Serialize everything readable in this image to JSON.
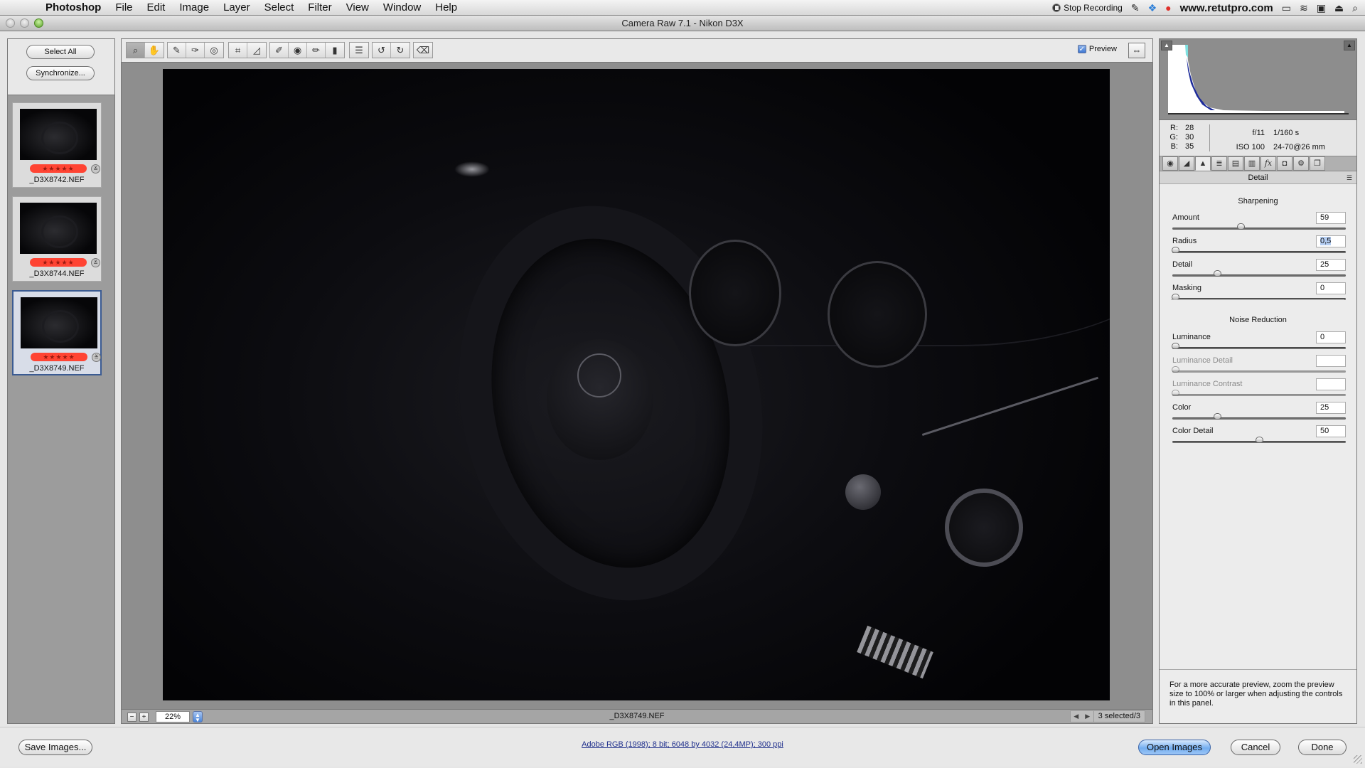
{
  "menubar": {
    "app_name": "Photoshop",
    "items": [
      "File",
      "Edit",
      "Image",
      "Layer",
      "Select",
      "Filter",
      "View",
      "Window",
      "Help"
    ],
    "right": {
      "recording_label": "Stop Recording",
      "site_label": "www.retutpro.com"
    }
  },
  "window": {
    "title": "Camera Raw 7.1  -  Nikon D3X"
  },
  "filmstrip": {
    "select_all_label": "Select All",
    "synchronize_label": "Synchronize...",
    "thumbnails": [
      {
        "name": "_D3X8742.NEF",
        "rating": 5,
        "selected": false
      },
      {
        "name": "_D3X8744.NEF",
        "rating": 5,
        "selected": false
      },
      {
        "name": "_D3X8749.NEF",
        "rating": 5,
        "selected": true
      }
    ],
    "stars_glyph": "★★★★★"
  },
  "toolbar": {
    "tools": [
      {
        "name": "zoom-tool",
        "glyph": "🔍",
        "active": true
      },
      {
        "name": "hand-tool",
        "glyph": "✋",
        "active": false
      },
      {
        "name": "white-balance-tool",
        "glyph": "✎",
        "active": false
      },
      {
        "name": "color-sampler-tool",
        "glyph": "✑",
        "active": false
      },
      {
        "name": "targeted-adjustment-tool",
        "glyph": "◎",
        "active": false
      },
      {
        "name": "crop-tool",
        "glyph": "⌗",
        "active": false
      },
      {
        "name": "straighten-tool",
        "glyph": "◿",
        "active": false
      },
      {
        "name": "spot-removal-tool",
        "glyph": "✐",
        "active": false
      },
      {
        "name": "red-eye-removal-tool",
        "glyph": "◉",
        "active": false
      },
      {
        "name": "adjustment-brush-tool",
        "glyph": "✏",
        "active": false
      },
      {
        "name": "graduated-filter-tool",
        "glyph": "▮",
        "active": false
      },
      {
        "name": "preferences-tool",
        "glyph": "☰",
        "active": false
      },
      {
        "name": "rotate-left-tool",
        "glyph": "↺",
        "active": false
      },
      {
        "name": "rotate-right-tool",
        "glyph": "↻",
        "active": false
      },
      {
        "name": "delete-tool",
        "glyph": "🗑",
        "active": false
      }
    ],
    "preview_label": "Preview",
    "preview_checked": true,
    "checkmark": "✓",
    "fullscreen_glyph": "⇔"
  },
  "status": {
    "zoom_out": "−",
    "zoom_in": "+",
    "zoom_level": "22%",
    "stepper_glyph": "▲▼",
    "filename": "_D3X8749.NEF",
    "prev_arrow": "◀",
    "next_arrow": "▶",
    "selection_count": "3 selected/3"
  },
  "histogram": {
    "shadow_clip_glyph": "▲",
    "highlight_clip_glyph": "▲",
    "readout": {
      "R": "28",
      "G": "30",
      "B": "35"
    },
    "labels": {
      "R": "R:",
      "G": "G:",
      "B": "B:"
    },
    "exif": {
      "aperture": "f/11",
      "shutter": "1/160 s",
      "iso": "ISO 100",
      "lens": "24-70@26 mm"
    }
  },
  "panel": {
    "tabs": [
      {
        "name": "basic",
        "glyph": "◉"
      },
      {
        "name": "tone-curve",
        "glyph": "◢"
      },
      {
        "name": "detail",
        "glyph": "▲",
        "active": true
      },
      {
        "name": "hsl",
        "glyph": "≣"
      },
      {
        "name": "split-toning",
        "glyph": "▤"
      },
      {
        "name": "lens-corrections",
        "glyph": "▥"
      },
      {
        "name": "effects",
        "glyph": "fx"
      },
      {
        "name": "camera-calibration",
        "glyph": "◘"
      },
      {
        "name": "presets",
        "glyph": "⚙"
      },
      {
        "name": "snapshots",
        "glyph": "❐"
      }
    ],
    "title": "Detail",
    "menu_glyph": "☰",
    "sharpening": {
      "title": "Sharpening",
      "sliders": [
        {
          "label": "Amount",
          "value": "59",
          "fraction": 0.39,
          "enabled": true,
          "selected": false
        },
        {
          "label": "Radius",
          "value": "0,5",
          "fraction": 0.0,
          "enabled": true,
          "selected": true
        },
        {
          "label": "Detail",
          "value": "25",
          "fraction": 0.25,
          "enabled": true,
          "selected": false
        },
        {
          "label": "Masking",
          "value": "0",
          "fraction": 0.0,
          "enabled": true,
          "selected": false
        }
      ]
    },
    "noise_reduction": {
      "title": "Noise Reduction",
      "sliders": [
        {
          "label": "Luminance",
          "value": "0",
          "fraction": 0.0,
          "enabled": true,
          "selected": false
        },
        {
          "label": "Luminance Detail",
          "value": "",
          "fraction": 0.0,
          "enabled": false,
          "selected": false
        },
        {
          "label": "Luminance Contrast",
          "value": "",
          "fraction": 0.0,
          "enabled": false,
          "selected": false
        },
        {
          "label": "Color",
          "value": "25",
          "fraction": 0.25,
          "enabled": true,
          "selected": false
        },
        {
          "label": "Color Detail",
          "value": "50",
          "fraction": 0.5,
          "enabled": true,
          "selected": false
        }
      ]
    },
    "note": "For a more accurate preview, zoom the preview size to 100% or larger when adjusting the controls in this panel."
  },
  "bottom": {
    "save_label": "Save Images...",
    "workflow_link": "Adobe RGB (1998); 8 bit; 6048 by 4032 (24,4MP); 300 ppi",
    "open_label": "Open Images",
    "cancel_label": "Cancel",
    "done_label": "Done"
  },
  "colors": {
    "accent_blue": "#3b5b92",
    "rating_red": "#ff4433",
    "link_blue": "#1f2f8c"
  }
}
